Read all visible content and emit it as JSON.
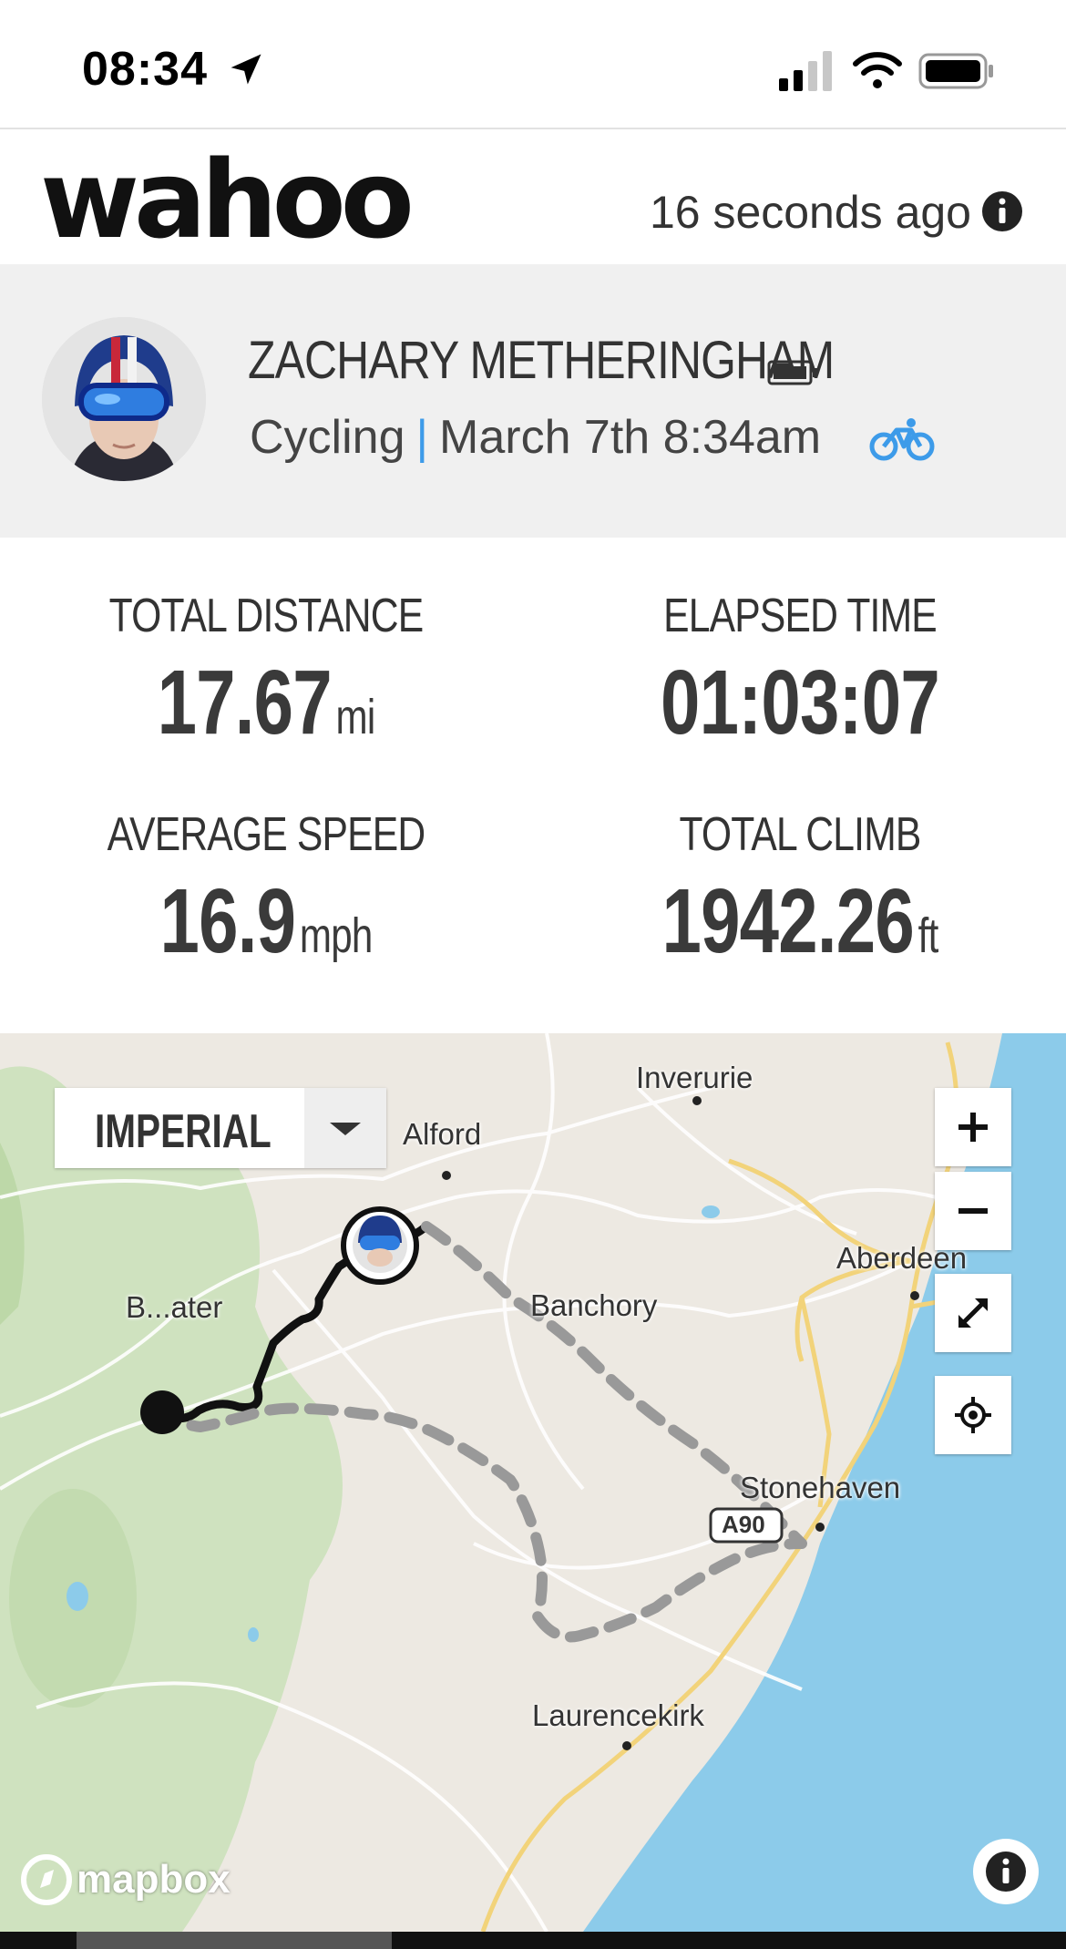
{
  "status_bar": {
    "time": "08:34"
  },
  "header": {
    "logo": "wahoo",
    "updated": "16 seconds ago"
  },
  "profile": {
    "name": "ZACHARY METHERINGHAM",
    "activity": "Cycling",
    "separator": "|",
    "date": "March 7th 8:34am"
  },
  "stats": {
    "distance": {
      "label": "TOTAL DISTANCE",
      "value": "17.67",
      "unit": "mi"
    },
    "elapsed": {
      "label": "ELAPSED TIME",
      "value": "01:03:07",
      "unit": ""
    },
    "speed": {
      "label": "AVERAGE SPEED",
      "value": "16.9",
      "unit": "mph"
    },
    "climb": {
      "label": "TOTAL CLIMB",
      "value": "1942.26",
      "unit": "ft"
    }
  },
  "map": {
    "units": "IMPERIAL",
    "towns": [
      "Inverurie",
      "Alford",
      "Aberdeen",
      "Banchory",
      "Stonehaven",
      "Laurencekirk",
      "B...ater"
    ],
    "road_label": "A90",
    "attribution": "mapbox",
    "colors": {
      "water": "#8ccbea",
      "park": "#cde0bd",
      "land": "#ede9e2",
      "route_done": "#111111",
      "route_planned": "#9a9a9a"
    }
  }
}
